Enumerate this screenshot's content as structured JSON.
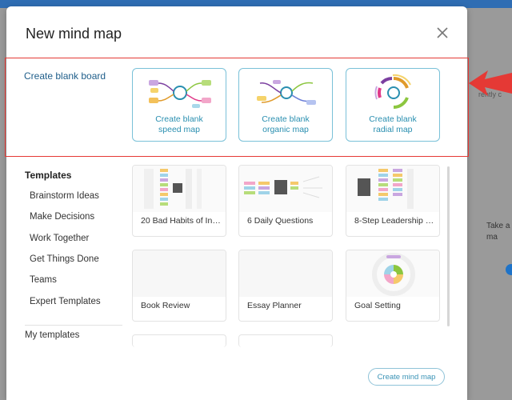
{
  "background": {
    "right_text": "Take a\nma",
    "right_text_top": "rently c"
  },
  "dialog": {
    "title": "New mind map",
    "close_icon": "close-icon"
  },
  "blank_board": {
    "label": "Create blank board",
    "cards": [
      {
        "line1": "Create blank",
        "line2": "speed map",
        "icon": "speed-map-icon"
      },
      {
        "line1": "Create blank",
        "line2": "organic map",
        "icon": "organic-map-icon"
      },
      {
        "line1": "Create blank",
        "line2": "radial map",
        "icon": "radial-map-icon"
      }
    ]
  },
  "templates": {
    "heading": "Templates",
    "categories": [
      "Brainstorm Ideas",
      "Make Decisions",
      "Work Together",
      "Get Things Done",
      "Teams",
      "Expert Templates"
    ],
    "my_templates": "My templates",
    "items": [
      {
        "label": "20 Bad Habits of Int…"
      },
      {
        "label": "6 Daily Questions"
      },
      {
        "label": "8-Step Leadership D…"
      },
      {
        "label": "Book Review"
      },
      {
        "label": "Essay Planner"
      },
      {
        "label": "Goal Setting"
      }
    ]
  },
  "footer": {
    "create_button": "Create mind map"
  },
  "colors": {
    "accent": "#2a8fb0",
    "highlight_border": "#e53935",
    "card_border": "#7ac1d8"
  }
}
